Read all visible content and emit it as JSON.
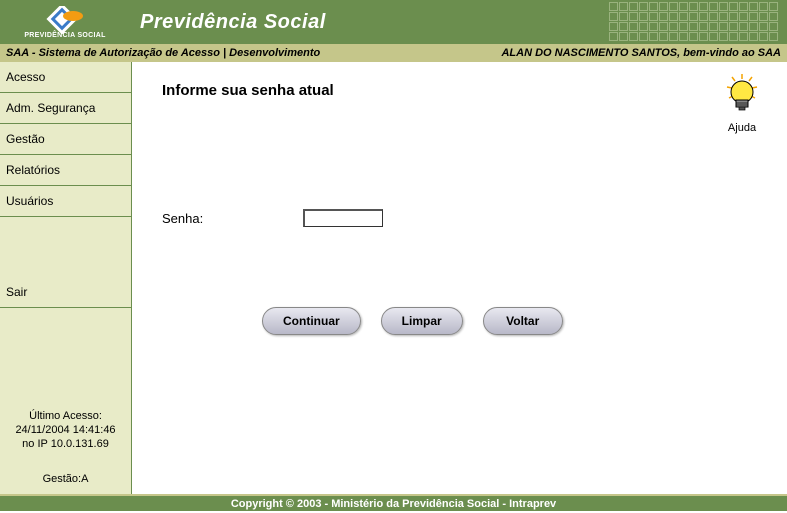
{
  "header": {
    "logo_text": "PREVIDÊNCIA SOCIAL",
    "title": "Previdência Social"
  },
  "subheader": {
    "left": "SAA - Sistema de Autorização de Acesso | Desenvolvimento",
    "right": "ALAN DO NASCIMENTO SANTOS, bem-vindo ao SAA"
  },
  "sidebar": {
    "items": [
      {
        "label": "Acesso"
      },
      {
        "label": "Adm. Segurança"
      },
      {
        "label": "Gestão"
      },
      {
        "label": "Relatórios"
      },
      {
        "label": "Usuários"
      }
    ],
    "exit": "Sair",
    "last_access_label": "Último Acesso:",
    "last_access_value": "24/11/2004 14:41:46",
    "last_access_ip": "no IP 10.0.131.69",
    "gestao": "Gestão:A"
  },
  "main": {
    "title": "Informe sua senha atual",
    "help_label": "Ajuda",
    "form_label": "Senha:",
    "form_value": "",
    "buttons": {
      "continuar": "Continuar",
      "limpar": "Limpar",
      "voltar": "Voltar"
    }
  },
  "footer": {
    "text": "Copyright © 2003 - Ministério da Previdência Social - Intraprev"
  }
}
